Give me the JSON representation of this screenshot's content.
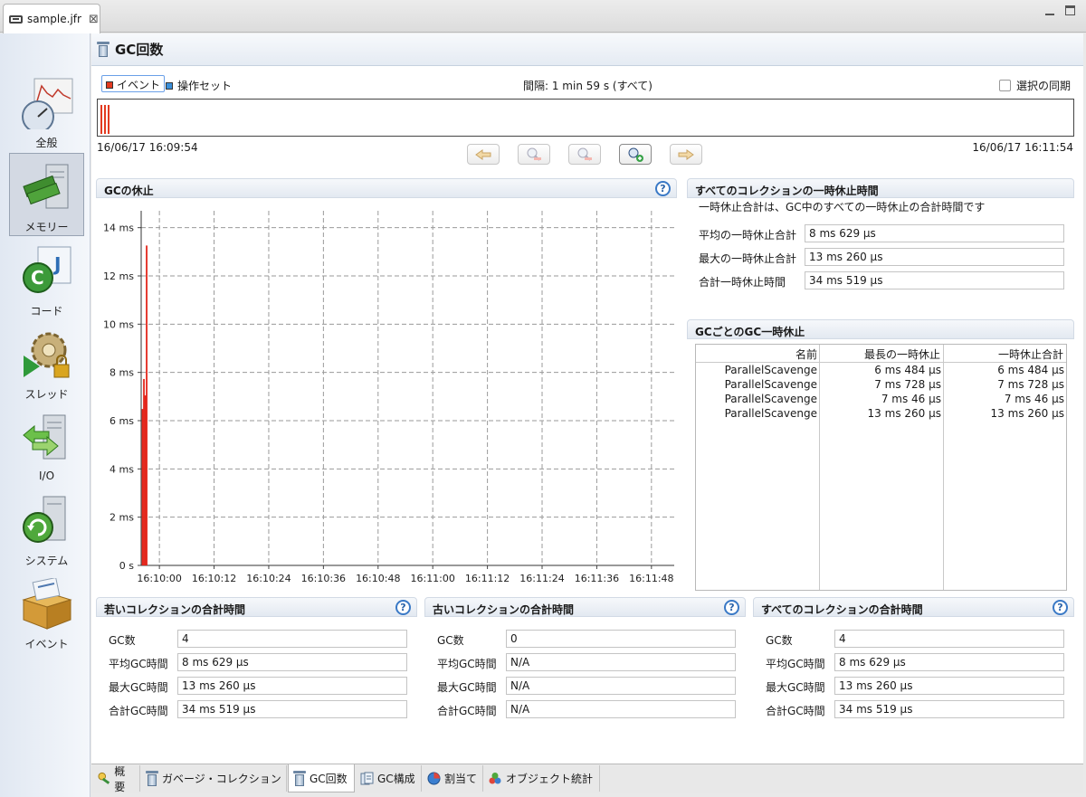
{
  "editor_tab": {
    "label": "sample.jfr",
    "close": "⊠"
  },
  "nav": {
    "items": [
      {
        "label": "全般"
      },
      {
        "label": "メモリー"
      },
      {
        "label": "コード"
      },
      {
        "label": "スレッド"
      },
      {
        "label": "I/O"
      },
      {
        "label": "システム"
      },
      {
        "label": "イベント"
      }
    ],
    "active_index": 1
  },
  "page": {
    "title": "GC回数"
  },
  "timeline": {
    "legend_event": "イベント",
    "legend_ops": "操作セット",
    "interval": "間隔: 1 min 59 s (すべて)",
    "sync_label": "選択の同期",
    "start": "16/06/17 16:09:54",
    "end": "16/06/17 16:11:54",
    "event_color": "#e33a20",
    "ops_color": "#3b8fd9"
  },
  "gc_pause_panel": {
    "title": "GCの休止",
    "help": "?"
  },
  "chart_data": {
    "type": "bar",
    "title": "GCの休止",
    "xlabel": "",
    "ylabel": "",
    "ylim": [
      0,
      14.7
    ],
    "xlim": [
      "16:09:56",
      "16:11:53"
    ],
    "y_ticks": [
      "0 s",
      "2 ms",
      "4 ms",
      "6 ms",
      "8 ms",
      "10 ms",
      "12 ms",
      "14 ms"
    ],
    "x_ticks": [
      "16:10:00",
      "16:10:12",
      "16:10:24",
      "16:10:36",
      "16:10:48",
      "16:11:00",
      "16:11:12",
      "16:11:24",
      "16:11:36",
      "16:11:48"
    ],
    "bar_color": "#e3261b",
    "grid": true,
    "series": [
      {
        "x": [
          "16:09:56.3",
          "16:09:56.6",
          "16:09:56.9",
          "16:09:57.2"
        ],
        "values": [
          6.484,
          7.728,
          7.046,
          13.26
        ]
      }
    ]
  },
  "all_pause_panel": {
    "title": "すべてのコレクションの一時休止時間",
    "description": "一時休止合計は、GC中のすべての一時休止の合計時間です",
    "rows": [
      {
        "label": "平均の一時休止合計",
        "value": "8 ms 629 μs"
      },
      {
        "label": "最大の一時休止合計",
        "value": "13 ms 260 μs"
      },
      {
        "label": "合計一時休止時間",
        "value": "34 ms 519 μs"
      }
    ]
  },
  "per_gc_panel": {
    "title": "GCごとのGC一時休止",
    "columns": [
      "名前",
      "最長の一時休止",
      "一時休止合計"
    ],
    "rows": [
      [
        "ParallelScavenge",
        "6 ms 484 μs",
        "6 ms 484 μs"
      ],
      [
        "ParallelScavenge",
        "7 ms 728 μs",
        "7 ms 728 μs"
      ],
      [
        "ParallelScavenge",
        "7 ms 46 μs",
        "7 ms 46 μs"
      ],
      [
        "ParallelScavenge",
        "13 ms 260 μs",
        "13 ms 260 μs"
      ]
    ]
  },
  "summary_panels": [
    {
      "title": "若いコレクションの合計時間",
      "help": "?",
      "rows": [
        {
          "label": "GC数",
          "value": "4"
        },
        {
          "label": "平均GC時間",
          "value": "8 ms 629 μs"
        },
        {
          "label": "最大GC時間",
          "value": "13 ms 260 μs"
        },
        {
          "label": "合計GC時間",
          "value": "34 ms 519 μs"
        }
      ]
    },
    {
      "title": "古いコレクションの合計時間",
      "help": "?",
      "rows": [
        {
          "label": "GC数",
          "value": "0"
        },
        {
          "label": "平均GC時間",
          "value": "N/A"
        },
        {
          "label": "最大GC時間",
          "value": "N/A"
        },
        {
          "label": "合計GC時間",
          "value": "N/A"
        }
      ]
    },
    {
      "title": "すべてのコレクションの合計時間",
      "help": "?",
      "rows": [
        {
          "label": "GC数",
          "value": "4"
        },
        {
          "label": "平均GC時間",
          "value": "8 ms 629 μs"
        },
        {
          "label": "最大GC時間",
          "value": "13 ms 260 μs"
        },
        {
          "label": "合計GC時間",
          "value": "34 ms 519 μs"
        }
      ]
    }
  ],
  "bottom_tabs": [
    {
      "label": "概要"
    },
    {
      "label": "ガベージ・コレクション"
    },
    {
      "label": "GC回数"
    },
    {
      "label": "GC構成"
    },
    {
      "label": "割当て"
    },
    {
      "label": "オブジェクト統計"
    }
  ]
}
